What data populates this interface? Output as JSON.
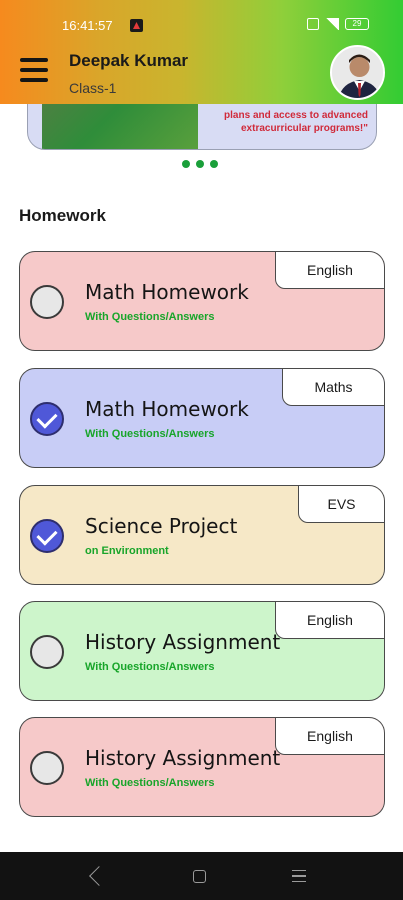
{
  "status_bar": {
    "time": "16:41:57",
    "battery": "29"
  },
  "header": {
    "user_name": "Deepak Kumar",
    "class_label": "Class-1",
    "menu_icon": "hamburger-menu-icon",
    "avatar": "user-avatar"
  },
  "banner": {
    "text": "plans and access to advanced extracurricular programs!\"",
    "accent_color": "#d02a3a",
    "carousel_dots": 3
  },
  "homework": {
    "section_title": "Homework",
    "items": [
      {
        "title": "Math Homework",
        "subtitle": "With Questions/Answers",
        "subject": "English",
        "completed": false,
        "bg_color": "#f6c9c9"
      },
      {
        "title": "Math Homework",
        "subtitle": "With Questions/Answers",
        "subject": "Maths",
        "completed": true,
        "bg_color": "#c8cdf6"
      },
      {
        "title": "Science Project",
        "subtitle": "on Environment",
        "subject": "EVS",
        "completed": true,
        "bg_color": "#f6e8c7"
      },
      {
        "title": "History Assignment",
        "subtitle": "With Questions/Answers",
        "subject": "English",
        "completed": false,
        "bg_color": "#cdf5cb"
      },
      {
        "title": "History Assignment",
        "subtitle": "With Questions/Answers",
        "subject": "English",
        "completed": false,
        "bg_color": "#f6c9c9"
      }
    ]
  },
  "colors": {
    "header_gradient_start": "#f68a1e",
    "header_gradient_end": "#33cc33",
    "subtitle_green": "#18a52a",
    "check_done": "#4f58d8"
  },
  "nav_bar": {
    "back_icon": "back-triangle-icon",
    "home_icon": "home-square-icon",
    "recent_icon": "recent-apps-icon"
  }
}
